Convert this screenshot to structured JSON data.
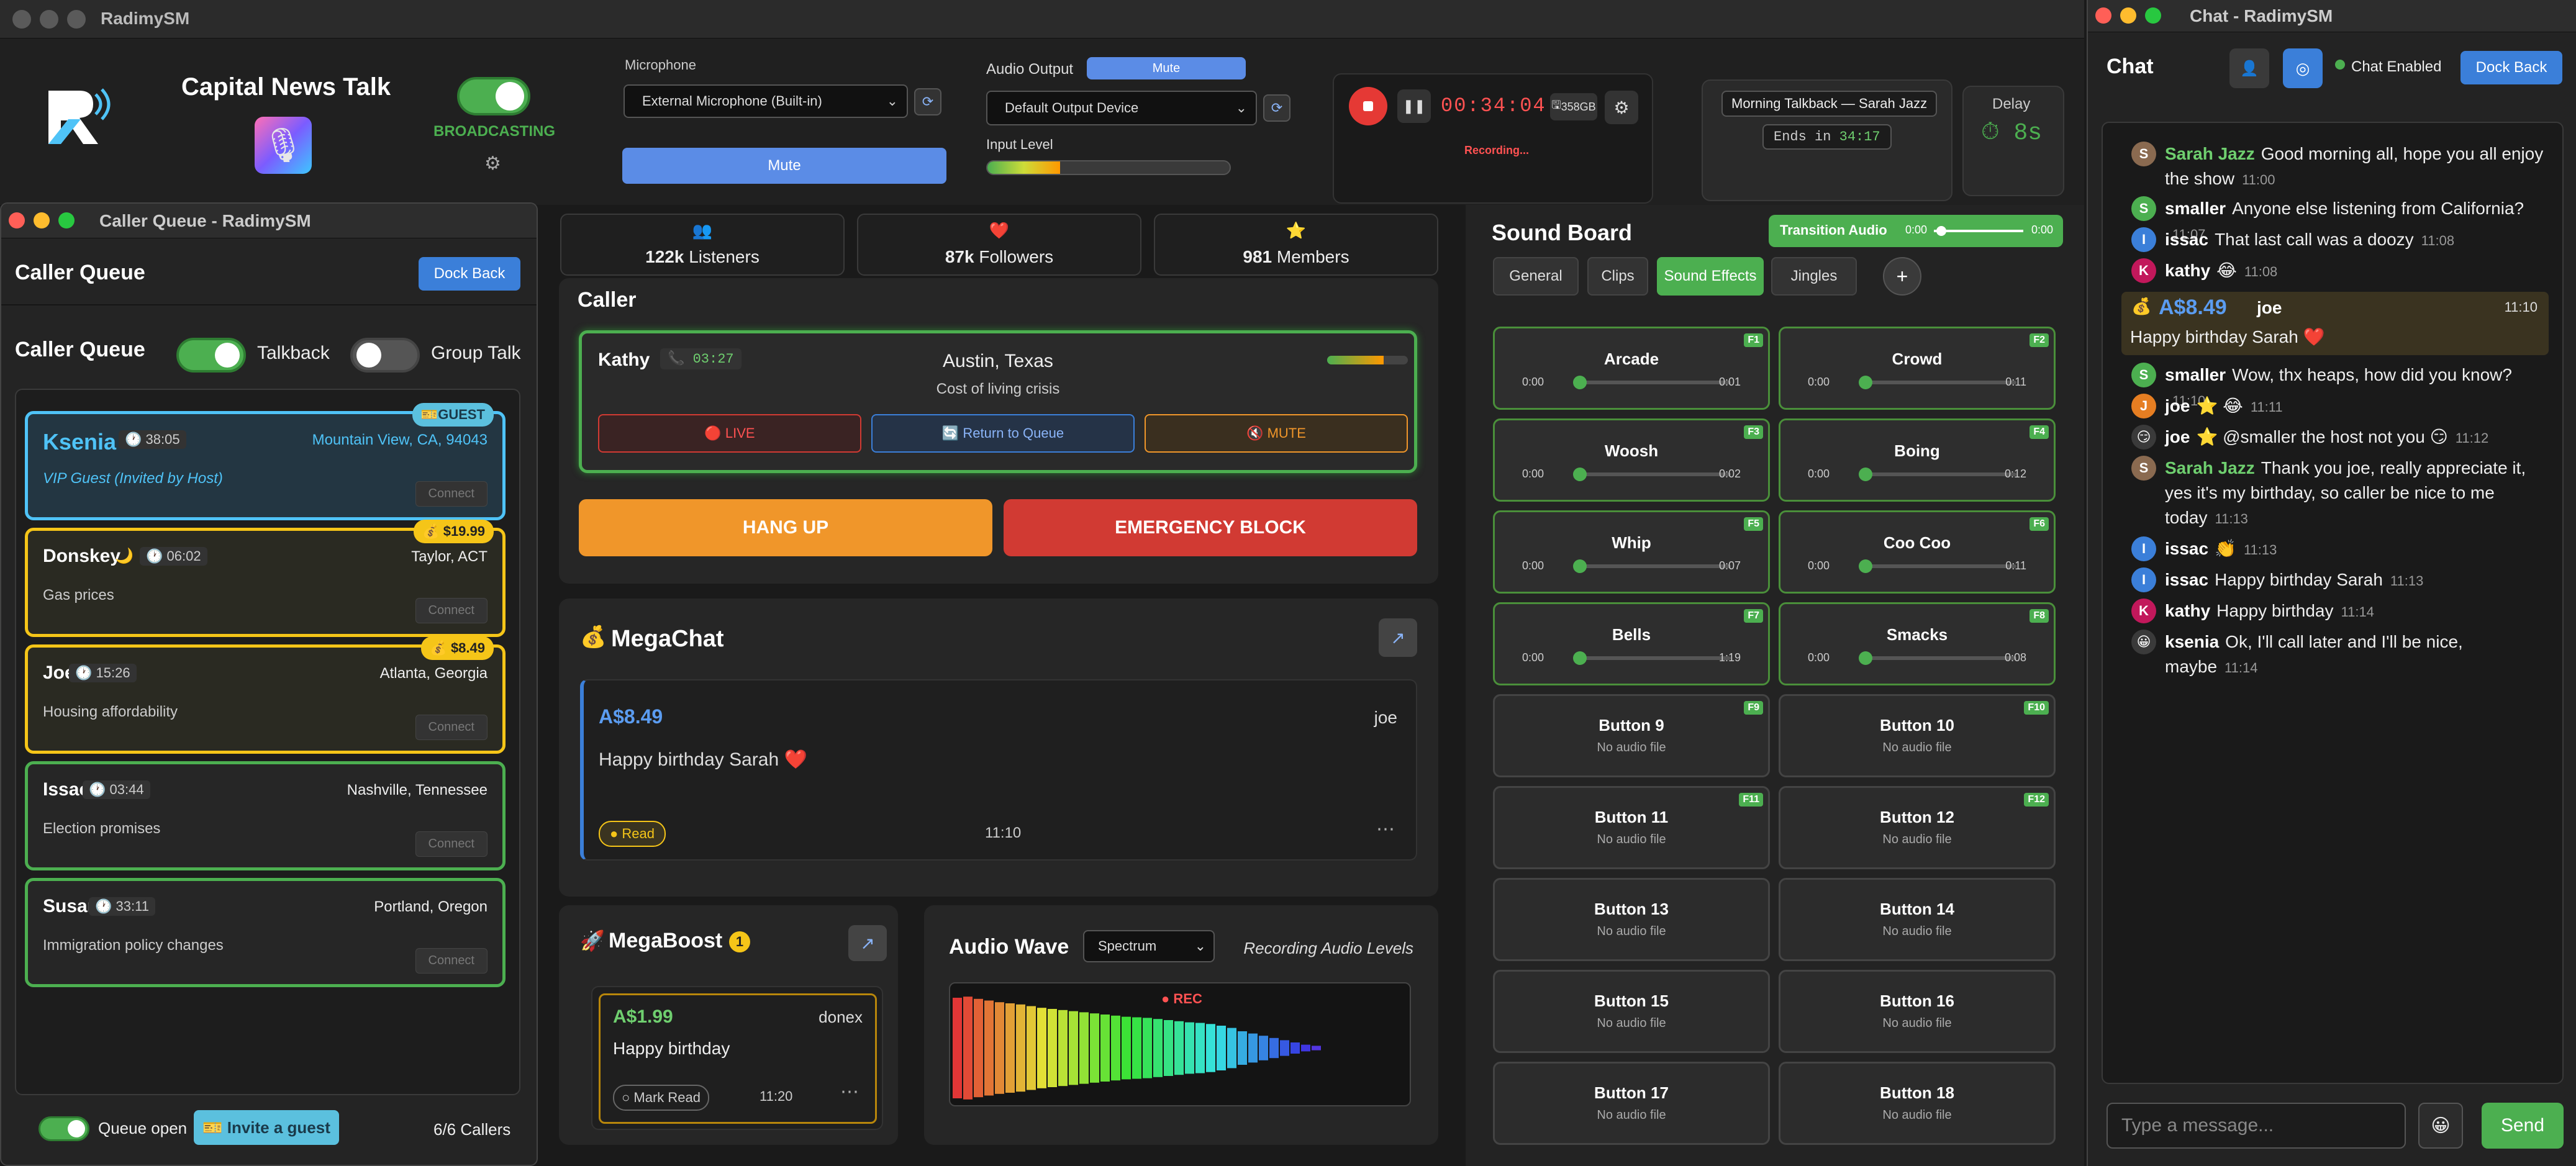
{
  "main_window": {
    "title": "RadimySM"
  },
  "station": {
    "name": "Capital News Talk",
    "status": "BROADCASTING"
  },
  "microphone": {
    "label": "Microphone",
    "device": "External Microphone (Built-in)",
    "mute": "Mute"
  },
  "audio_output": {
    "label": "Audio Output",
    "mute": "Mute",
    "device": "Default Output Device",
    "input_level_label": "Input Level",
    "input_level": 0.3
  },
  "recorder": {
    "time": "00:34:04",
    "disk": "358GB",
    "status": "Recording..."
  },
  "show": {
    "title": "Morning Talkback — Sarah Jazz",
    "ends_label": "Ends in",
    "ends_time": "34:17"
  },
  "delay": {
    "label": "Delay",
    "value": "8s"
  },
  "stats": [
    {
      "value": "122k",
      "label": "Listeners"
    },
    {
      "value": "87k",
      "label": "Followers"
    },
    {
      "value": "981",
      "label": "Members"
    }
  ],
  "caller_queue": {
    "window_title": "Caller Queue - RadimySM",
    "header": "Caller Queue",
    "dock_back": "Dock Back",
    "title": "Caller Queue",
    "talkback": "Talkback",
    "group_talk": "Group Talk",
    "queue_open": "Queue open",
    "invite": "Invite a guest",
    "count": "6/6 Callers",
    "callers": [
      {
        "name": "Ksenia",
        "time": "38:05",
        "location": "Mountain View, CA, 94043",
        "topic": "VIP Guest (Invited by Host)",
        "badge": "GUEST",
        "connect": "Connect",
        "color": "#4fc3f7"
      },
      {
        "name": "Donskey",
        "time": "06:02",
        "location": "Taylor, ACT",
        "topic": "Gas prices",
        "badge": "$19.99",
        "connect": "Connect",
        "color": "#f5c518"
      },
      {
        "name": "Joe",
        "time": "15:26",
        "location": "Atlanta, Georgia",
        "topic": "Housing affordability",
        "badge": "$8.49",
        "connect": "Connect",
        "color": "#f5c518"
      },
      {
        "name": "Issac",
        "time": "03:44",
        "location": "Nashville, Tennessee",
        "topic": "Election promises",
        "badge": "",
        "connect": "Connect",
        "color": "#4caf50"
      },
      {
        "name": "Susan",
        "time": "33:11",
        "location": "Portland, Oregon",
        "topic": "Immigration policy changes",
        "badge": "",
        "connect": "Connect",
        "color": "#4caf50"
      }
    ]
  },
  "caller": {
    "header": "Caller",
    "name": "Kathy",
    "time": "03:27",
    "location": "Austin, Texas",
    "topic": "Cost of living crisis",
    "live": "LIVE",
    "return": "Return to Queue",
    "mute": "MUTE",
    "hang_up": "HANG UP",
    "emergency": "EMERGENCY BLOCK"
  },
  "megachat": {
    "title": "MegaChat",
    "amount": "A$8.49",
    "user": "joe",
    "message": "Happy birthday Sarah ❤️",
    "read": "● Read",
    "time": "11:10"
  },
  "megaboost": {
    "title": "MegaBoost",
    "count": "1",
    "amount": "A$1.99",
    "user": "donex",
    "message": "Happy birthday",
    "mark_read": "○ Mark Read",
    "time": "11:20"
  },
  "audio_wave": {
    "title": "Audio Wave",
    "mode": "Spectrum",
    "subtitle": "Recording Audio Levels",
    "rec": "REC",
    "levels": [
      0.9,
      0.92,
      0.88,
      0.85,
      0.82,
      0.8,
      0.78,
      0.75,
      0.72,
      0.7,
      0.68,
      0.66,
      0.64,
      0.62,
      0.6,
      0.58,
      0.56,
      0.55,
      0.54,
      0.52,
      0.5,
      0.48,
      0.46,
      0.45,
      0.43,
      0.4,
      0.36,
      0.3,
      0.26,
      0.22,
      0.18,
      0.14,
      0.1,
      0.06,
      0.04
    ]
  },
  "sound_board": {
    "title": "Sound Board",
    "transition_label": "Transition Audio",
    "transition_start": "0:00",
    "transition_end": "0:00",
    "tabs": [
      "General",
      "Clips",
      "Sound Effects",
      "Jingles"
    ],
    "active_tab": 2,
    "buttons": [
      {
        "name": "Arcade",
        "key": "F1",
        "start": "0:00",
        "end": "0:01"
      },
      {
        "name": "Crowd",
        "key": "F2",
        "start": "0:00",
        "end": "0:11"
      },
      {
        "name": "Woosh",
        "key": "F3",
        "start": "0:00",
        "end": "0:02"
      },
      {
        "name": "Boing",
        "key": "F4",
        "start": "0:00",
        "end": "0:12"
      },
      {
        "name": "Whip",
        "key": "F5",
        "start": "0:00",
        "end": "0:07"
      },
      {
        "name": "Coo Coo",
        "key": "F6",
        "start": "0:00",
        "end": "0:11"
      },
      {
        "name": "Bells",
        "key": "F7",
        "start": "0:00",
        "end": "1:19"
      },
      {
        "name": "Smacks",
        "key": "F8",
        "start": "0:00",
        "end": "0:08"
      },
      {
        "name": "Button 9",
        "key": "F9",
        "sub": "No audio file"
      },
      {
        "name": "Button 10",
        "key": "F10",
        "sub": "No audio file"
      },
      {
        "name": "Button 11",
        "key": "F11",
        "sub": "No audio file"
      },
      {
        "name": "Button 12",
        "key": "F12",
        "sub": "No audio file"
      },
      {
        "name": "Button 13",
        "key": "",
        "sub": "No audio file"
      },
      {
        "name": "Button 14",
        "key": "",
        "sub": "No audio file"
      },
      {
        "name": "Button 15",
        "key": "",
        "sub": "No audio file"
      },
      {
        "name": "Button 16",
        "key": "",
        "sub": "No audio file"
      },
      {
        "name": "Button 17",
        "key": "",
        "sub": "No audio file"
      },
      {
        "name": "Button 18",
        "key": "",
        "sub": "No audio file"
      }
    ]
  },
  "chat": {
    "window_title": "Chat - RadimySM",
    "title": "Chat",
    "enabled": "Chat Enabled",
    "dock_back": "Dock Back",
    "placeholder": "Type a message...",
    "send": "Send",
    "messages": [
      {
        "user": "Sarah Jazz",
        "text": "Good morning all, hope you all enjoy the show",
        "time": "11:00",
        "avatar": "S",
        "color": "#8a6a50",
        "user_color": "#6fcf6f"
      },
      {
        "user": "smaller",
        "text": "Anyone else listening from California?",
        "time": "11:07",
        "avatar": "S",
        "color": "#4caf50",
        "user_color": "#ffffff"
      },
      {
        "user": "issac",
        "text": "That last call was a doozy",
        "time": "11:08",
        "avatar": "I",
        "color": "#3b7fd9",
        "user_color": "#ffffff"
      },
      {
        "user": "kathy",
        "text": "😂",
        "time": "11:08",
        "avatar": "K",
        "color": "#c2185b",
        "user_color": "#ffffff"
      },
      {
        "user": "smaller",
        "text": "Wow, thx heaps, how did you know?",
        "time": "11:10",
        "avatar": "S",
        "color": "#4caf50",
        "user_color": "#ffffff"
      },
      {
        "user": "joe",
        "text": "⭐ 😂",
        "time": "11:11",
        "avatar": "J",
        "color": "#e67e22",
        "user_color": "#ffffff"
      },
      {
        "user": "joe",
        "text": "⭐ @smaller the host not you 😏",
        "time": "11:12",
        "avatar": "😏",
        "color": "#3a3a3a",
        "user_color": "#ffffff"
      },
      {
        "user": "Sarah Jazz",
        "text": "Thank you joe, really appreciate it, yes it's my birthday, so caller be nice to me today",
        "time": "11:13",
        "avatar": "S",
        "color": "#8a6a50",
        "user_color": "#6fcf6f"
      },
      {
        "user": "issac",
        "text": "👏",
        "time": "11:13",
        "avatar": "I",
        "color": "#3b7fd9",
        "user_color": "#ffffff"
      },
      {
        "user": "issac",
        "text": "Happy birthday Sarah",
        "time": "11:13",
        "avatar": "I",
        "color": "#3b7fd9",
        "user_color": "#ffffff"
      },
      {
        "user": "kathy",
        "text": "Happy birthday",
        "time": "11:14",
        "avatar": "K",
        "color": "#c2185b",
        "user_color": "#ffffff"
      },
      {
        "user": "ksenia",
        "text": "Ok, I'll call later and I'll be nice, maybe",
        "time": "11:14",
        "avatar": "😀",
        "color": "#3a3a3a",
        "user_color": "#ffffff"
      }
    ],
    "highlight": {
      "amount": "A$8.49",
      "user": "joe",
      "time": "11:10",
      "text": "Happy birthday Sarah ❤️"
    }
  },
  "colors": {
    "accent": "#3b7fd9",
    "green": "#4caf50",
    "orange": "#f0962a",
    "red": "#d13a33",
    "gold": "#f5c518"
  }
}
